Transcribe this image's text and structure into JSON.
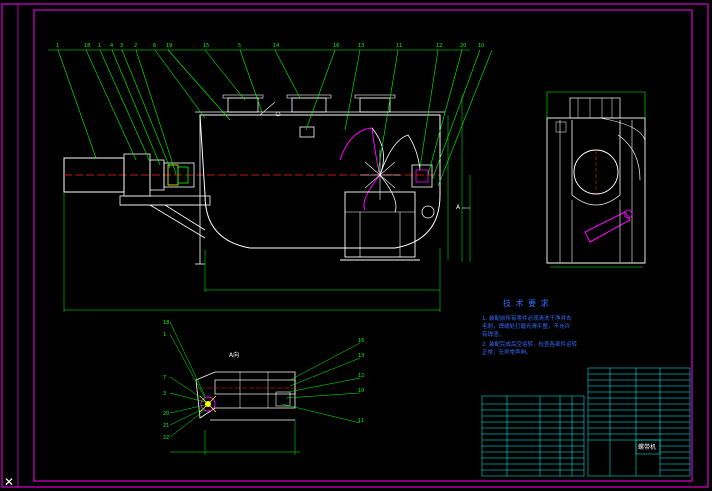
{
  "drawing": {
    "colors": {
      "background": "#000000",
      "frame": "#ff00ff",
      "leader": "#00ff00",
      "outline": "#ffffff",
      "centerline": "#ff2020",
      "hatch": "#ff00ff",
      "note_text": "#3a6cff",
      "table": "#00ffff"
    },
    "callouts_top": [
      "1",
      "18",
      "1",
      "4",
      "3",
      "2",
      "6",
      "19",
      "15",
      "5",
      "14",
      "16",
      "13",
      "11",
      "12",
      "20",
      "10"
    ],
    "section_label": "A向",
    "callouts_section_left": [
      "18",
      "1",
      "7",
      "3",
      "20",
      "21",
      "22"
    ],
    "callouts_section_right": [
      "16",
      "13",
      "12",
      "10",
      "11"
    ],
    "notes": {
      "title": "技 术 要 求",
      "lines": [
        "1. 装配前所有零件必须清洗干净并去",
        "   毛刺，焊缝处打磨光滑平整，不允许",
        "   有焊渣。",
        "2. 装配完成后空运转，检查各部件运转",
        "   正常，无异常声响。"
      ]
    },
    "title_block": {
      "name": "螺带机"
    },
    "dim_side": "A"
  }
}
